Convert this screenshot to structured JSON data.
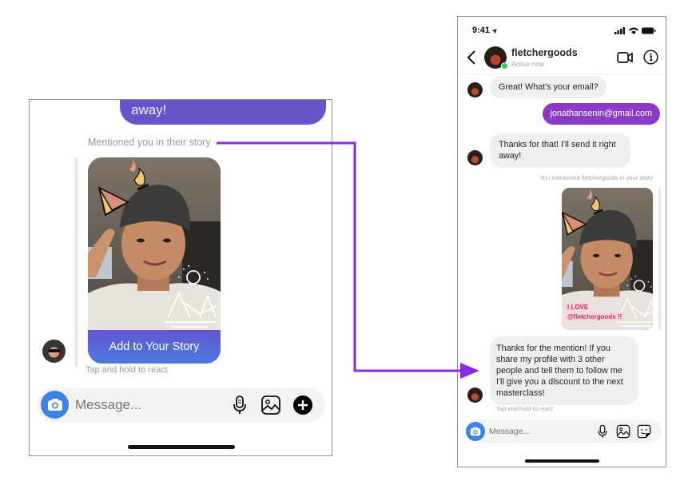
{
  "left_panel": {
    "top_bubble_text": "away!",
    "mention_label": "Mentioned you in their story",
    "add_to_story_label": "Add to Your Story",
    "tap_hold_hint": "Tap and hold to react",
    "composer": {
      "placeholder": "Message...",
      "icons": [
        "camera-icon",
        "microphone-icon",
        "gallery-icon",
        "plus-circle-icon"
      ]
    },
    "colors": {
      "bubble": "#6654c9",
      "add_story_gradient": [
        "#6257d0",
        "#4a7ae0"
      ],
      "camera": "#3d82e6"
    }
  },
  "right_panel": {
    "status_bar": {
      "time": "9:41",
      "location_arrow": "➤"
    },
    "header": {
      "username": "fletchergoods",
      "status": "Active now",
      "icons": [
        "back-chevron-icon",
        "video-call-icon",
        "info-icon"
      ]
    },
    "messages": [
      {
        "from": "them",
        "text": "Great! What's your email?"
      },
      {
        "from": "me",
        "text": "jonathansenin@gmail.com"
      },
      {
        "from": "them",
        "text": "Thanks for that! I'll send it right away!"
      },
      {
        "from": "system",
        "text": "You mentioned fletchergoods in your story"
      },
      {
        "from": "me",
        "type": "story",
        "sticker_line1": "I LOVE",
        "sticker_line2": "@fletchergoods !!"
      },
      {
        "from": "them",
        "text": "Thanks for the mention! If you share my profile with 3 other people and tell them to follow me I'll give you a discount to the next masterclass!"
      }
    ],
    "tap_hold_hint": "Tap and hold to react",
    "composer": {
      "placeholder": "Message...",
      "icons": [
        "camera-icon",
        "microphone-icon",
        "gallery-icon",
        "sticker-icon"
      ]
    },
    "colors": {
      "outgoing_bubble": "#8a3bc6",
      "online_dot": "#3ec55a",
      "camera": "#3d82e6"
    }
  },
  "annotation": {
    "arrow_color": "#8a2be2"
  }
}
